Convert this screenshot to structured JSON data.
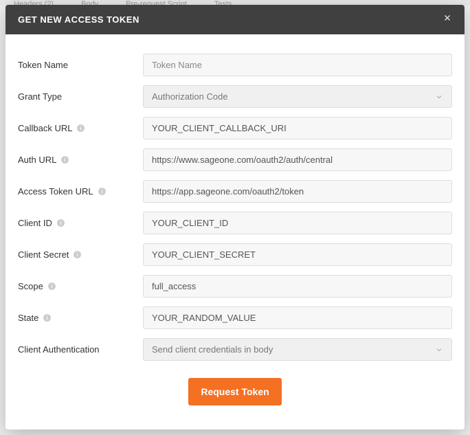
{
  "backdrop": {
    "tabs": [
      "Headers (2)",
      "Body",
      "Pre-request Script",
      "Tests"
    ]
  },
  "modal": {
    "title": "GET NEW ACCESS TOKEN"
  },
  "form": {
    "token_name": {
      "label": "Token Name",
      "placeholder": "Token Name",
      "value": ""
    },
    "grant_type": {
      "label": "Grant Type",
      "selected": "Authorization Code"
    },
    "callback_url": {
      "label": "Callback URL",
      "value": "YOUR_CLIENT_CALLBACK_URI"
    },
    "auth_url": {
      "label": "Auth URL",
      "value": "https://www.sageone.com/oauth2/auth/central"
    },
    "access_token_url": {
      "label": "Access Token URL",
      "value": "https://app.sageone.com/oauth2/token"
    },
    "client_id": {
      "label": "Client ID",
      "value": "YOUR_CLIENT_ID"
    },
    "client_secret": {
      "label": "Client Secret",
      "value": "YOUR_CLIENT_SECRET"
    },
    "scope": {
      "label": "Scope",
      "value": "full_access"
    },
    "state": {
      "label": "State",
      "value": "YOUR_RANDOM_VALUE"
    },
    "client_auth": {
      "label": "Client Authentication",
      "selected": "Send client credentials in body"
    }
  },
  "actions": {
    "request_token": "Request Token"
  }
}
